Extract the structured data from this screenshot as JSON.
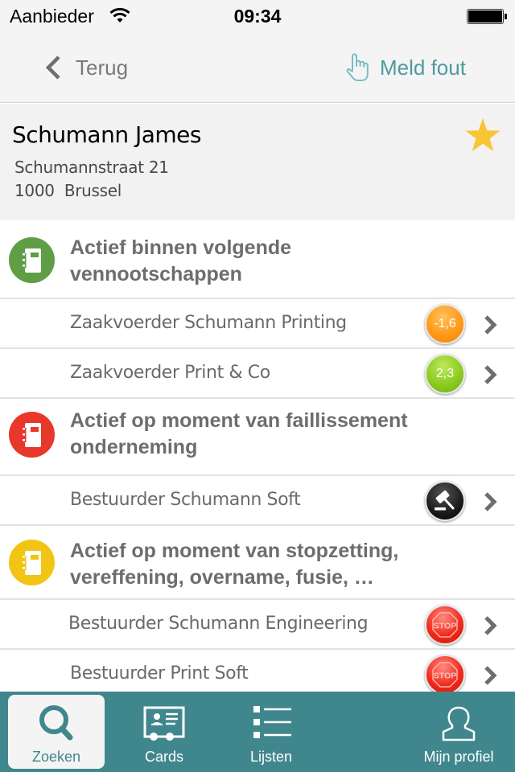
{
  "status_bar": {
    "carrier": "Aanbieder",
    "time": "09:34",
    "wifi_icon": "wifi-icon",
    "battery_icon": "battery-full-icon"
  },
  "nav": {
    "back_label": "Terug",
    "back_icon": "chevron-left-icon",
    "report_label": "Meld fout",
    "report_icon": "pointing-hand-icon"
  },
  "person": {
    "name": "Schumann James",
    "street": "Schumannstraat 21",
    "city": "1000  Brussel",
    "favorite": true,
    "favorite_color": "#f8c633"
  },
  "sections": [
    {
      "title_line1": "Actief binnen volgende",
      "title_line2": "vennootschappen",
      "icon": "notebook-icon",
      "color": "#5f9e45",
      "rows": [
        {
          "label": "Zaakvoerder Schumann Printing",
          "badge_type": "score",
          "badge_text": "-1,6",
          "badge_color": "orange"
        },
        {
          "label": "Zaakvoerder Print & Co",
          "badge_type": "score",
          "badge_text": "2,3",
          "badge_color": "green"
        }
      ]
    },
    {
      "title_line1": "Actief op moment van faillissement",
      "title_line2": "onderneming",
      "icon": "notebook-icon",
      "color": "#e8372b",
      "rows": [
        {
          "label": "Bestuurder Schumann Soft",
          "badge_type": "gavel",
          "badge_text": "",
          "badge_color": "black"
        }
      ]
    },
    {
      "title_line1": "Actief op moment van stopzetting,",
      "title_line2": "vereffening, overname, fusie, …",
      "icon": "notebook-icon",
      "color": "#f2c414",
      "rows": [
        {
          "label": "Bestuurder Schumann Engineering",
          "badge_type": "stop",
          "badge_text": "STOP",
          "badge_color": "red"
        },
        {
          "label": "Bestuurder Print Soft",
          "badge_type": "stop",
          "badge_text": "STOP",
          "badge_color": "red"
        }
      ]
    }
  ],
  "tab_bar": {
    "background": "#40878d",
    "tabs": [
      {
        "label": "Zoeken",
        "icon": "search-icon",
        "active": true
      },
      {
        "label": "Cards",
        "icon": "id-card-icon",
        "active": false
      },
      {
        "label": "Lijsten",
        "icon": "list-icon",
        "active": false
      },
      {
        "label": "Mijn profiel",
        "icon": "user-icon",
        "active": false
      }
    ]
  }
}
